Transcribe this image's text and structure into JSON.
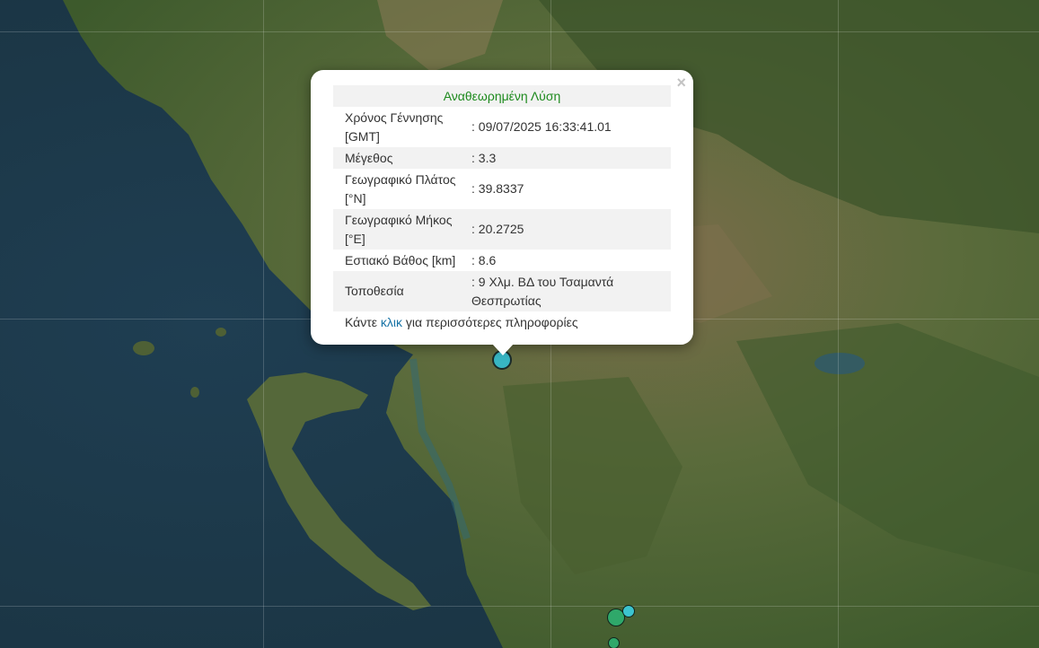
{
  "popup": {
    "title": "Αναθεωρημένη Λύση",
    "close_symbol": "×",
    "rows": [
      {
        "label": "Χρόνος Γέννησης [GMT]",
        "value": ": 09/07/2025 16:33:41.01"
      },
      {
        "label": "Μέγεθος",
        "value": ": 3.3"
      },
      {
        "label": "Γεωγραφικό Πλάτος [°N]",
        "value": ": 39.8337"
      },
      {
        "label": "Γεωγραφικό Μήκος [°E]",
        "value": ": 20.2725"
      },
      {
        "label": "Εστιακό Βάθος [km]",
        "value": ": 8.6"
      },
      {
        "label": "Τοποθεσία",
        "value": ": 9 Χλμ. ΒΔ του Τσαμαντά Θεσπρωτίας"
      }
    ],
    "footer": {
      "prefix": "Κάντε ",
      "link": "κλικ",
      "suffix": " για περισσότερες πληροφορίες"
    }
  },
  "markers": [
    {
      "id": "main",
      "color": "#38b6c4"
    },
    {
      "id": "2",
      "color": "#2fa86a"
    },
    {
      "id": "3",
      "color": "#3cc4cf"
    },
    {
      "id": "4",
      "color": "#2fa86a"
    }
  ],
  "colors": {
    "sea": "#1d3a4c",
    "land": "#5a6a3a",
    "title_green": "#1d8a1d",
    "link_blue": "#1773a6"
  }
}
